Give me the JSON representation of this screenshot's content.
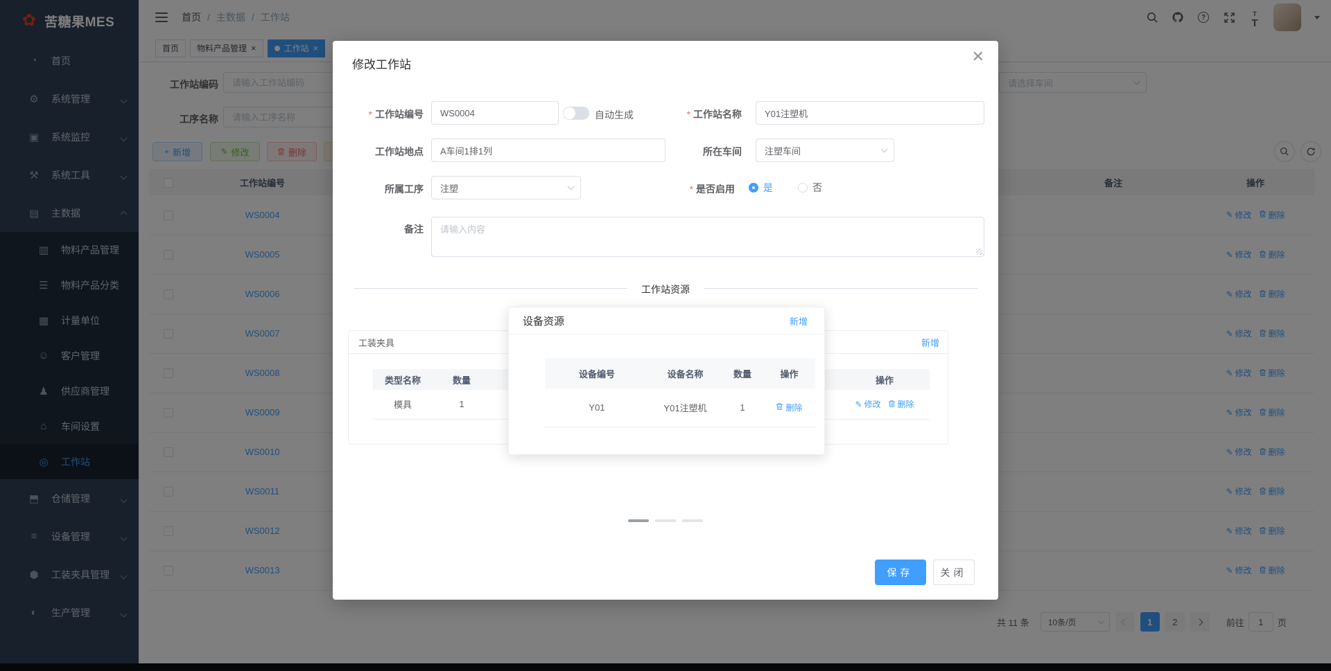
{
  "colors": {
    "primary": "#409eff",
    "success": "#67c23a",
    "danger": "#f56c6c",
    "warning": "#e6a23c",
    "sidebar_bg": "#304156"
  },
  "app": {
    "logo_text": "苦糖果MES"
  },
  "header": {
    "breadcrumb": [
      "首页",
      "主数据",
      "工作站"
    ]
  },
  "tabs": [
    {
      "label": "首页",
      "closable": false,
      "active": false
    },
    {
      "label": "物料产品管理",
      "closable": true,
      "active": false
    },
    {
      "label": "工作站",
      "closable": true,
      "active": true
    }
  ],
  "sidebar": {
    "menu": [
      {
        "id": "home",
        "label": "首页",
        "icon": "dashboard-icon",
        "type": "item"
      },
      {
        "id": "system-management",
        "label": "系统管理",
        "icon": "gear-icon",
        "type": "group"
      },
      {
        "id": "system-monitor",
        "label": "系统监控",
        "icon": "monitor-icon",
        "type": "group"
      },
      {
        "id": "system-tools",
        "label": "系统工具",
        "icon": "toolbox-icon",
        "type": "group"
      },
      {
        "id": "master-data",
        "label": "主数据",
        "icon": "database-icon",
        "type": "group",
        "expanded": true,
        "children": [
          {
            "id": "material-product-management",
            "label": "物料产品管理",
            "icon": "material-icon"
          },
          {
            "id": "material-product-category",
            "label": "物料产品分类",
            "icon": "category-icon"
          },
          {
            "id": "measure-unit",
            "label": "计量单位",
            "icon": "unit-icon"
          },
          {
            "id": "customer-management",
            "label": "客户管理",
            "icon": "customer-icon"
          },
          {
            "id": "supplier-management",
            "label": "供应商管理",
            "icon": "supplier-icon"
          },
          {
            "id": "workshop-settings",
            "label": "车间设置",
            "icon": "workshop-icon"
          },
          {
            "id": "workstation",
            "label": "工作站",
            "icon": "workstation-icon",
            "active": true
          }
        ]
      },
      {
        "id": "warehouse-management",
        "label": "仓储管理",
        "icon": "warehouse-icon",
        "type": "group"
      },
      {
        "id": "equipment-management",
        "label": "设备管理",
        "icon": "equipment-icon",
        "type": "group"
      },
      {
        "id": "fixture-management",
        "label": "工装夹具管理",
        "icon": "fixture-icon",
        "type": "group"
      },
      {
        "id": "production-management",
        "label": "生产管理",
        "icon": "production-icon",
        "type": "group"
      }
    ]
  },
  "filters": {
    "code_label": "工作站编码",
    "code_placeholder": "请输入工作站编码",
    "process_label": "工序名称",
    "process_placeholder": "请输入工序名称",
    "workshop_placeholder": "请选择车间"
  },
  "toolbar": {
    "buttons": [
      {
        "id": "add",
        "label": "新增",
        "type": "primary",
        "icon": "plus-icon"
      },
      {
        "id": "edit",
        "label": "修改",
        "type": "success",
        "icon": "edit-icon"
      },
      {
        "id": "delete",
        "label": "删除",
        "type": "danger",
        "icon": "delete-icon"
      },
      {
        "id": "partial",
        "label": "",
        "type": "warning",
        "icon": ""
      }
    ]
  },
  "table": {
    "columns": [
      "工作站编号",
      "备注",
      "操作"
    ],
    "rows": [
      "WS0004",
      "WS0005",
      "WS0006",
      "WS0007",
      "WS0008",
      "WS0009",
      "WS0010",
      "WS0011",
      "WS0012",
      "WS0013"
    ],
    "row_actions": [
      "修改",
      "删除"
    ]
  },
  "pagination": {
    "total_text": "共 11 条",
    "page_size": "10条/页",
    "pages": [
      "1",
      "2"
    ],
    "active_page": "1",
    "goto_label": "前往",
    "goto_value": "1",
    "goto_suffix": "页"
  },
  "modal": {
    "title": "修改工作站",
    "fields": {
      "code_label": "工作站编号",
      "code_value": "WS0004",
      "auto_label": "自动生成",
      "name_label": "工作站名称",
      "name_value": "Y01注塑机",
      "location_label": "工作站地点",
      "location_value": "A车间1排1列",
      "workshop_label": "所在车间",
      "workshop_value": "注塑车间",
      "process_label": "所属工序",
      "process_value": "注塑",
      "enabled_label": "是否启用",
      "enabled_yes": "是",
      "enabled_no": "否",
      "remark_label": "备注",
      "remark_placeholder": "请输入内容"
    },
    "section_title": "工作站资源",
    "panels": [
      {
        "id": "fixture",
        "title": "工装夹具",
        "add_label": "新增",
        "columns": [
          "类型名称",
          "数量",
          "操作"
        ],
        "rows": [
          [
            "模具",
            "1"
          ]
        ],
        "row_actions": [
          "修改",
          "删除"
        ]
      },
      {
        "id": "right",
        "title": "",
        "add_label": "新增",
        "columns": [
          "",
          "数量",
          "操作"
        ],
        "rows": [
          [
            "",
            "1"
          ]
        ],
        "row_actions": [
          "修改",
          "删除"
        ]
      }
    ],
    "popup": {
      "title": "设备资源",
      "add_label": "新增",
      "columns": [
        "设备编号",
        "设备名称",
        "数量",
        "操作"
      ],
      "rows": [
        [
          "Y01",
          "Y01注塑机",
          "1"
        ]
      ],
      "row_action": "删除"
    },
    "footer": {
      "save_label": "保存",
      "close_label": "关闭"
    }
  }
}
